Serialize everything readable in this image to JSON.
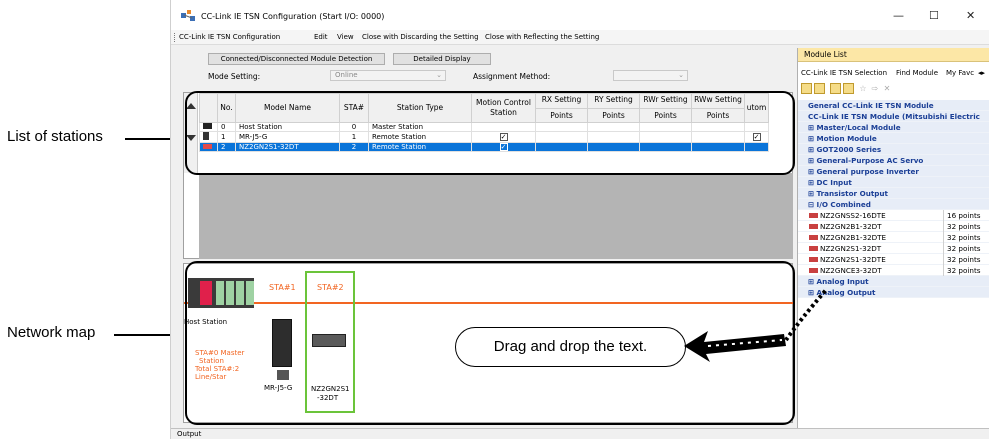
{
  "callouts": {
    "list_of_stations": "List of stations",
    "network_map": "Network map",
    "drag_hint": "Drag and drop the text."
  },
  "window": {
    "title": "CC-Link IE TSN Configuration (Start I/O: 0000)",
    "minimize": "—",
    "maximize": "☐",
    "close": "✕"
  },
  "menu": {
    "items": [
      "CC-Link IE TSN Configuration",
      "Edit",
      "View",
      "Close with Discarding the Setting",
      "Close with Reflecting the Setting"
    ]
  },
  "top_panel": {
    "btn_detection": "Connected/Disconnected Module Detection",
    "btn_detailed": "Detailed Display",
    "mode_label": "Mode Setting:",
    "mode_value": "Online",
    "assignment_label": "Assignment Method:",
    "assignment_value": ""
  },
  "grid": {
    "headers": {
      "no": "No.",
      "model": "Model Name",
      "sta": "STA#",
      "type": "Station Type",
      "motion": "Motion Control Station",
      "rx": "RX Setting",
      "ry": "RY Setting",
      "rwr": "RWr Setting",
      "rww": "RWw Setting",
      "auto": "utom",
      "points": "Points"
    },
    "rows": [
      {
        "no": "0",
        "model": "Host Station",
        "sta": "0",
        "type": "Master Station",
        "motion": false,
        "auto": false,
        "selected": false
      },
      {
        "no": "1",
        "model": "MR-J5-G",
        "sta": "1",
        "type": "Remote Station",
        "motion": true,
        "auto": true,
        "selected": false
      },
      {
        "no": "2",
        "model": "NZ2GN2S1-32DT",
        "sta": "2",
        "type": "Remote Station",
        "motion": true,
        "auto": false,
        "selected": true
      }
    ]
  },
  "network_map": {
    "sta1": "STA#1",
    "sta2": "STA#2",
    "host_label": "Host Station",
    "host_info": [
      "STA#0  Master",
      "Station",
      "Total STA#:2",
      "Line/Star"
    ],
    "servo_label": "MR-J5-G",
    "io_label_line1": "NZ2GN2S1",
    "io_label_line2": "-32DT",
    "line_color": "#f26522",
    "highlight_color": "#6bc43a"
  },
  "module_list": {
    "title": "Module List",
    "tabs": [
      "CC-Link IE TSN Selection",
      "Find Module",
      "My Favc"
    ],
    "tab_arrow": "◂▸",
    "rows": [
      {
        "kind": "cat",
        "text": "General CC-Link IE TSN Module"
      },
      {
        "kind": "cat",
        "text": "CC-Link IE TSN Module (Mitsubishi Electric"
      },
      {
        "kind": "cat",
        "text": "⊞ Master/Local Module"
      },
      {
        "kind": "cat",
        "text": "⊞ Motion Module"
      },
      {
        "kind": "cat",
        "text": "⊞ GOT2000 Series"
      },
      {
        "kind": "cat",
        "text": "⊞ General-Purpose AC Servo"
      },
      {
        "kind": "cat",
        "text": "⊞ General purpose Inverter"
      },
      {
        "kind": "cat",
        "text": "⊞ DC Input"
      },
      {
        "kind": "cat",
        "text": "⊞ Transistor Output"
      },
      {
        "kind": "cat",
        "text": "⊟ I/O Combined"
      },
      {
        "kind": "item",
        "text": "NZ2GNSS2-16DTE",
        "points": "16 points"
      },
      {
        "kind": "item",
        "text": "NZ2GN2B1-32DT",
        "points": "32 points"
      },
      {
        "kind": "item",
        "text": "NZ2GN2B1-32DTE",
        "points": "32 points"
      },
      {
        "kind": "item",
        "text": "NZ2GN2S1-32DT",
        "points": "32 points"
      },
      {
        "kind": "item",
        "text": "NZ2GN2S1-32DTE",
        "points": "32 points"
      },
      {
        "kind": "item",
        "text": "NZ2GNCE3-32DT",
        "points": "32 points"
      },
      {
        "kind": "cat",
        "text": "⊞ Analog Input"
      },
      {
        "kind": "cat",
        "text": "⊞ Analog Output"
      }
    ]
  },
  "output": {
    "label": "Output"
  },
  "colors": {
    "selection": "#0a74d9",
    "module_list_title": "#fce7a6",
    "category_text": "#1b3f96"
  }
}
